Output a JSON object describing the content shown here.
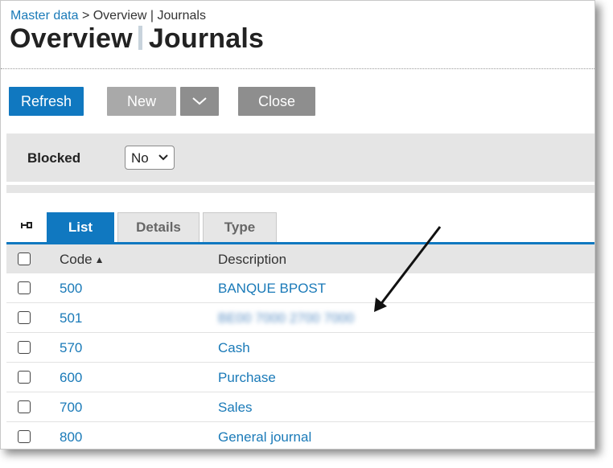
{
  "breadcrumb": {
    "master_data": "Master data",
    "separator": ">",
    "current": "Overview | Journals"
  },
  "title": {
    "part1": "Overview",
    "part2": "Journals"
  },
  "toolbar": {
    "refresh_label": "Refresh",
    "new_label": "New",
    "close_label": "Close"
  },
  "filter": {
    "label": "Blocked",
    "value": "No"
  },
  "tabs": [
    {
      "label": "List",
      "active": true
    },
    {
      "label": "Details",
      "active": false
    },
    {
      "label": "Type",
      "active": false
    }
  ],
  "table": {
    "columns": {
      "code": "Code",
      "description": "Description"
    },
    "rows": [
      {
        "code": "500",
        "description": "BANQUE BPOST"
      },
      {
        "code": "501",
        "description": "BE00 7000 2700 7000"
      },
      {
        "code": "570",
        "description": "Cash"
      },
      {
        "code": "600",
        "description": "Purchase"
      },
      {
        "code": "700",
        "description": "Sales"
      },
      {
        "code": "800",
        "description": "General journal"
      }
    ]
  },
  "colors": {
    "accent": "#1078c0",
    "link": "#1a7ab8",
    "button_gray": "#8e8e8e",
    "panel_gray": "#e5e5e5"
  },
  "icons": [
    "pin-icon",
    "chevron-down-icon",
    "sort-ascending-icon",
    "annotation-arrow-icon"
  ]
}
